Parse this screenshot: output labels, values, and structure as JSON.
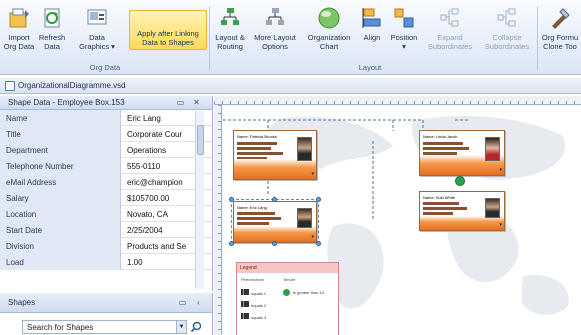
{
  "ribbon": {
    "groups": {
      "org_data": "Org Data",
      "layout": "Layout"
    },
    "buttons": {
      "import": "Import\nOrg Data",
      "refresh": "Refresh\nData",
      "data_graphics": "Data\nGraphics ▾",
      "apply_after_linking": "Apply after Linking\nData to Shapes",
      "layout_routing": "Layout &\nRouting",
      "more_layout": "More Layout\nOptions",
      "org_chart": "Organization\nChart",
      "align": "Align",
      "position": "Position\n▾",
      "expand": "Expand\nSubordinates",
      "collapse": "Collapse\nSubordinates",
      "org_formula": "Org Formu\nClone Too"
    }
  },
  "document": {
    "tab": "OrganizationalDiagramme.vsd"
  },
  "shape_data": {
    "title": "Shape Data - Employee Box.153",
    "rows": [
      {
        "key": "Name",
        "value": "Eric Lang"
      },
      {
        "key": "Title",
        "value": "Corporate Cour"
      },
      {
        "key": "Department",
        "value": "Operations"
      },
      {
        "key": "Telephone Number",
        "value": "555-0110"
      },
      {
        "key": "eMail Address",
        "value": "eric@champion"
      },
      {
        "key": "Salary",
        "value": "$105700.00"
      },
      {
        "key": "Location",
        "value": "Novato, CA"
      },
      {
        "key": "Start Date",
        "value": "2/25/2004"
      },
      {
        "key": "Division",
        "value": "Products and Se"
      },
      {
        "key": "Load",
        "value": "1.00"
      }
    ]
  },
  "shapes": {
    "title": "Shapes",
    "search_value": "Search for Shapes"
  },
  "diagram": {
    "cards": [
      {
        "name": "Name: Patricia Brooks"
      },
      {
        "name": "Name: Eric Lang"
      },
      {
        "name": "Name: Linda Jacob"
      },
      {
        "name": "Name: Suki White"
      }
    ],
    "legend": {
      "title": "Legend",
      "performance": "Performance",
      "tenure": "Tenure",
      "items": [
        "equals 1",
        "equals 2",
        "equals 3"
      ],
      "tenure_item": "is greater than 10"
    }
  }
}
